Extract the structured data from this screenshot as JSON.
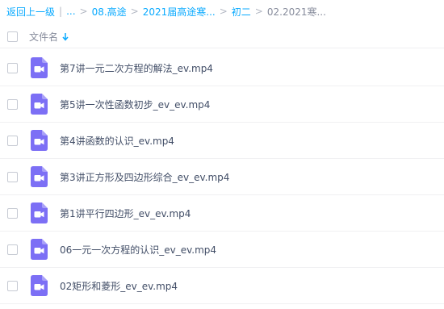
{
  "breadcrumb": {
    "back": "返回上一级",
    "divider": "|",
    "ellipsis": "...",
    "sep": ">",
    "items": [
      "08.高途",
      "2021届高途寒...",
      "初二"
    ],
    "current": "02.2021寒..."
  },
  "header": {
    "column_label": "文件名",
    "sort_icon": "arrow-down-icon"
  },
  "colors": {
    "accent": "#09aaff",
    "file_icon": "#7c6ff5"
  },
  "files": [
    {
      "name": "第7讲一元二次方程的解法_ev.mp4",
      "icon": "video-file-icon"
    },
    {
      "name": "第5讲一次性函数初步_ev_ev.mp4",
      "icon": "video-file-icon"
    },
    {
      "name": "第4讲函数的认识_ev.mp4",
      "icon": "video-file-icon"
    },
    {
      "name": "第3讲正方形及四边形综合_ev_ev.mp4",
      "icon": "video-file-icon"
    },
    {
      "name": "第1讲平行四边形_ev_ev.mp4",
      "icon": "video-file-icon"
    },
    {
      "name": "06一元一次方程的认识_ev_ev.mp4",
      "icon": "video-file-icon"
    },
    {
      "name": "02矩形和菱形_ev_ev.mp4",
      "icon": "video-file-icon"
    }
  ]
}
